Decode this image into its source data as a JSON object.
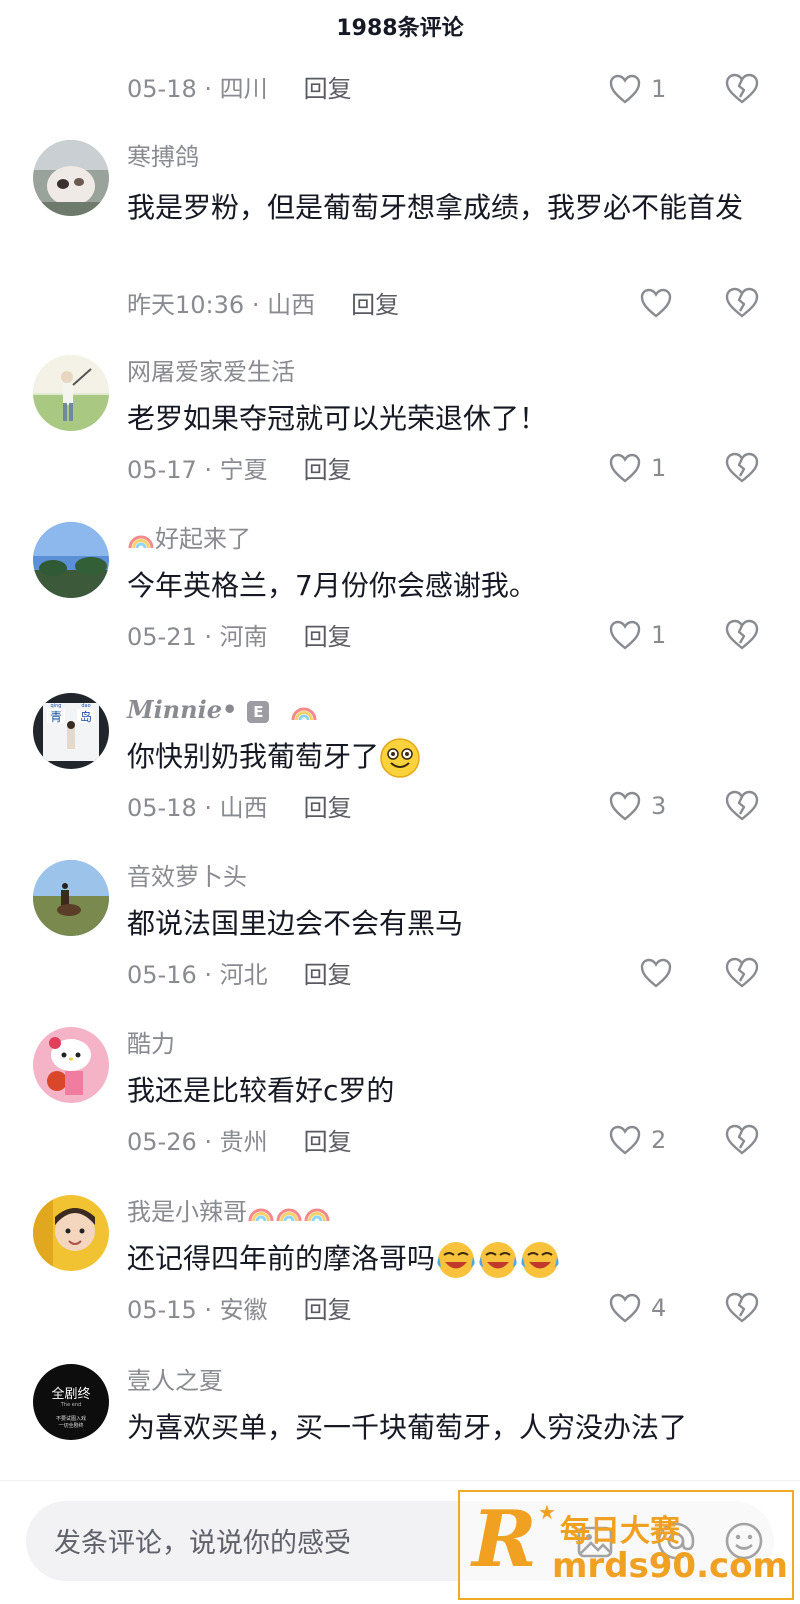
{
  "header": {
    "title": "1988条评论"
  },
  "first_meta": {
    "date": "05-18",
    "region": "四川",
    "reply": "回复",
    "likes": "1"
  },
  "comments": [
    {
      "user": "寒搏鸽",
      "text": "我是罗粉，但是葡萄牙想拿成绩，我罗必不能首发",
      "date": "昨天10:36",
      "region": "山西",
      "reply": "回复",
      "likes": ""
    },
    {
      "user": "网屠爱家爱生活",
      "text": "老罗如果夺冠就可以光荣退休了！",
      "date": "05-17",
      "region": "宁夏",
      "reply": "回复",
      "likes": "1"
    },
    {
      "user": "好起来了",
      "text": "今年英格兰，7月份你会感谢我。",
      "date": "05-21",
      "region": "河南",
      "reply": "回复",
      "likes": "1"
    },
    {
      "user": "Minnie•",
      "badge": "E",
      "text": "你快别奶我葡萄牙了",
      "date": "05-18",
      "region": "山西",
      "reply": "回复",
      "likes": "3"
    },
    {
      "user": "音效萝卜头",
      "text": "都说法国里边会不会有黑马",
      "date": "05-16",
      "region": "河北",
      "reply": "回复",
      "likes": ""
    },
    {
      "user": "酷力",
      "text": "我还是比较看好c罗的",
      "date": "05-26",
      "region": "贵州",
      "reply": "回复",
      "likes": "2"
    },
    {
      "user": "我是小辣哥",
      "text": "还记得四年前的摩洛哥吗",
      "date": "05-15",
      "region": "安徽",
      "reply": "回复",
      "likes": "4"
    },
    {
      "user": "壹人之夏",
      "text": "为喜欢买单，买一千块葡萄牙，人穷没办法了"
    }
  ],
  "avatar_text": {
    "qingdao_left": "青",
    "qingdao_right": "岛",
    "qd_small_l": "qing",
    "qd_small_r": "dao",
    "quanjuzhong": "全剧终",
    "quanjuzhong_sub": "The end",
    "quanjuzhong_line2": "不要试图入戏",
    "quanjuzhong_line3": "一切全剧终"
  },
  "separator": "·",
  "input": {
    "placeholder": "发条评论，说说你的感受"
  },
  "watermark": {
    "letter": "R",
    "name": "每日大赛",
    "url": "mrds90.com"
  },
  "icons": {
    "like": "heart-outline-icon",
    "dislike": "broken-heart-icon",
    "image": "image-icon",
    "mention": "at-icon",
    "emoji": "smile-icon"
  },
  "colors": {
    "text": "#161823",
    "meta": "#8a8b91",
    "watermark": "#f0a122"
  }
}
